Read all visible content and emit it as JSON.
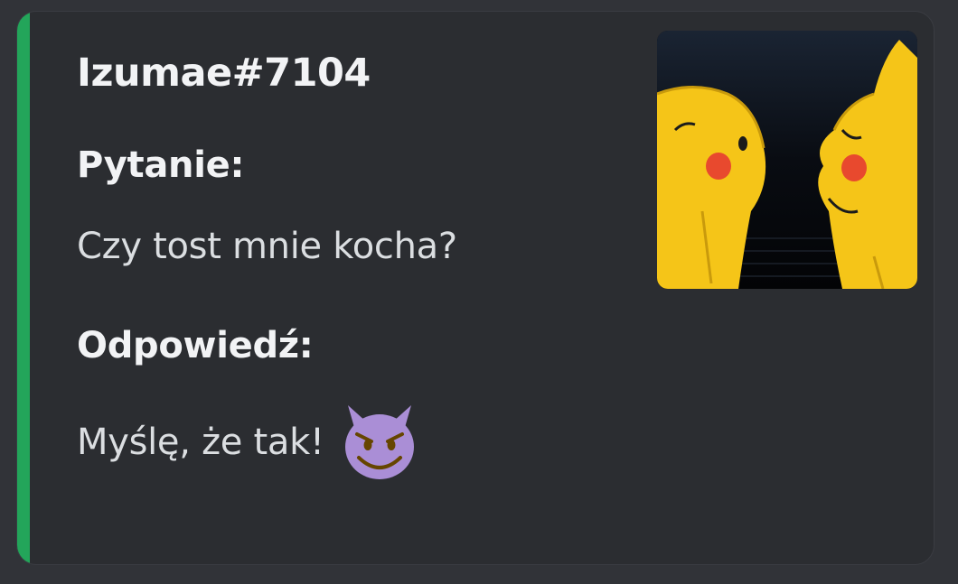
{
  "embed": {
    "accent_color": "#23a55a",
    "author": "Izumae#7104",
    "fields": [
      {
        "name": "Pytanie:",
        "value": "Czy tost mnie kocha?"
      },
      {
        "name": "Odpowiedź:",
        "value": "Myślę, że tak!"
      }
    ],
    "answer_emoji": "smiling-imp-emoji",
    "thumbnail_icon": "pikachu-thumbnail-image"
  }
}
